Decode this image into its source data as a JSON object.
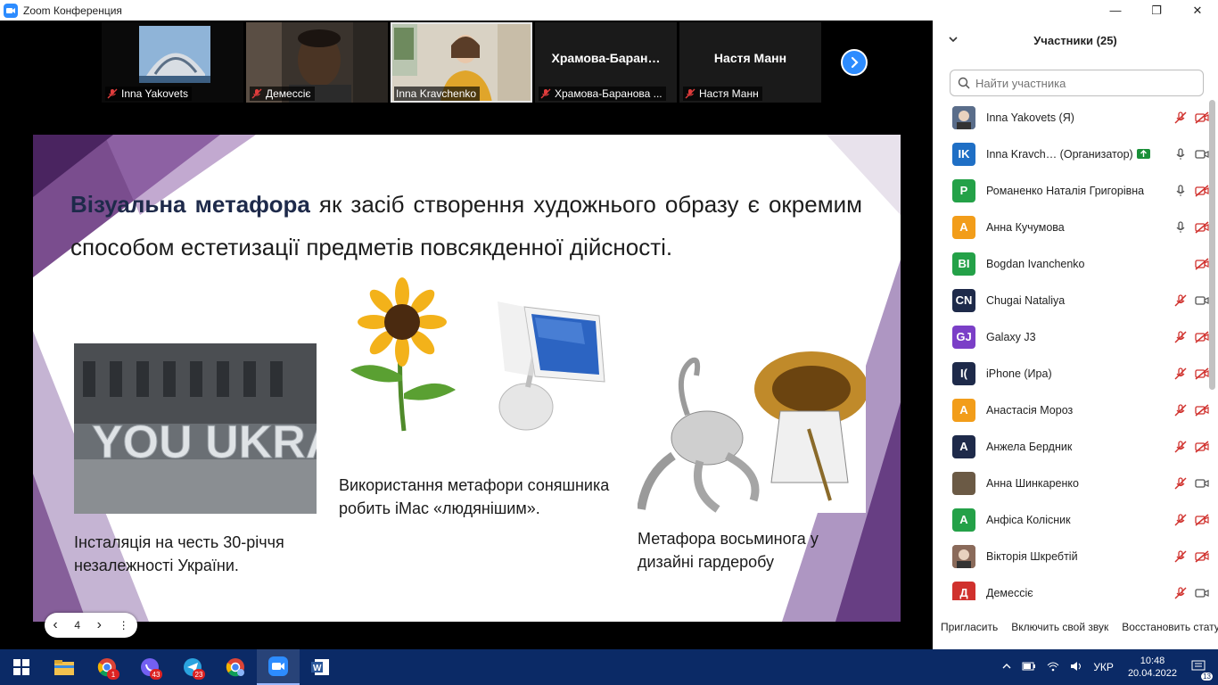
{
  "window": {
    "title": "Zoom Конференция"
  },
  "window_controls": {
    "minimize": "—",
    "restore": "❐",
    "close": "✕"
  },
  "thumbnails": [
    {
      "name": "Inna Yakovets",
      "type": "photo"
    },
    {
      "name": "Демессіє",
      "type": "video"
    },
    {
      "name": "Inna Kravchenko",
      "type": "video",
      "active": true
    },
    {
      "name": "Храмова-Баранова ...",
      "bigname": "Храмова-Баран…",
      "type": "text"
    },
    {
      "name": "Настя Манн",
      "bigname": "Настя Манн",
      "type": "text"
    }
  ],
  "slide": {
    "headline_accent_1": "Візуальна",
    "headline_accent_2": "метафора",
    "headline_rest": " як засіб створення художнього образу є окремим способом естетизації предметів повсякденної дійсності.",
    "caption_left": "Інсталяція на честь 30-річчя незалежності України.",
    "caption_middle": "Використання метафори соняшника робить iMac «людянішим».",
    "caption_right": "Метафора восьминога у дизайні гардеробу",
    "sign_text": "YOU UKRAINE"
  },
  "slide_controls": {
    "prev": "‹",
    "page": "4",
    "next": "›",
    "more": "⋮"
  },
  "panel": {
    "title": "Участники (25)",
    "search_placeholder": "Найти участника",
    "participants": [
      {
        "initials": "",
        "name": "Inna Yakovets (Я)",
        "color": "#5a6d8a",
        "photo": true,
        "mic": "muted",
        "cam": "off"
      },
      {
        "initials": "IK",
        "name": "Inna Kravch… (Организатор)",
        "color": "#1f6fc5",
        "share": true,
        "mic": "on",
        "cam": "on"
      },
      {
        "initials": "Р",
        "name": "Романенко Наталія Григорівна",
        "color": "#24a148",
        "mic": "on",
        "cam": "off"
      },
      {
        "initials": "А",
        "name": "Анна Кучумова",
        "color": "#f29d1a",
        "mic": "on",
        "cam": "off"
      },
      {
        "initials": "BI",
        "name": "Bogdan Ivanchenko",
        "color": "#24a148",
        "mic": "none",
        "cam": "off"
      },
      {
        "initials": "CN",
        "name": "Chugai Nataliya",
        "color": "#1e2a4a",
        "mic": "muted",
        "cam": "on"
      },
      {
        "initials": "GJ",
        "name": "Galaxy J3",
        "color": "#7b3fc7",
        "mic": "muted",
        "cam": "off"
      },
      {
        "initials": "I(",
        "name": "iPhone (Ира)",
        "color": "#1e2a4a",
        "mic": "muted",
        "cam": "off"
      },
      {
        "initials": "А",
        "name": "Анастасія Мороз",
        "color": "#f29d1a",
        "mic": "muted",
        "cam": "off"
      },
      {
        "initials": "А",
        "name": "Анжела Бердник",
        "color": "#1e2a4a",
        "mic": "muted",
        "cam": "off"
      },
      {
        "initials": "",
        "name": "Анна Шинкаренко",
        "color": "#6b5a45",
        "mic": "muted",
        "cam": "on"
      },
      {
        "initials": "А",
        "name": "Анфіса Колісник",
        "color": "#24a148",
        "mic": "muted",
        "cam": "off"
      },
      {
        "initials": "",
        "name": "Вікторія Шкребтій",
        "color": "#8a6a5a",
        "photo": true,
        "mic": "muted",
        "cam": "off"
      },
      {
        "initials": "Д",
        "name": "Демессіє",
        "color": "#d0312d",
        "mic": "muted",
        "cam": "on"
      }
    ],
    "footer": {
      "invite": "Пригласить",
      "unmute_self": "Включить свой звук",
      "restore": "Восстановить стату"
    }
  },
  "taskbar": {
    "apps": [
      {
        "icon": "windows-start-icon"
      },
      {
        "icon": "file-explorer-icon"
      },
      {
        "icon": "chrome-icon",
        "badge": "1"
      },
      {
        "icon": "viber-icon",
        "badge": "43"
      },
      {
        "icon": "telegram-icon",
        "badge": "23"
      },
      {
        "icon": "chrome-profile-icon"
      },
      {
        "icon": "zoom-icon",
        "active": true
      },
      {
        "icon": "word-icon"
      }
    ],
    "tray": {
      "lang": "УКР",
      "time": "10:48",
      "date": "20.04.2022",
      "notifications": "13"
    }
  },
  "colors": {
    "zoom_blue": "#2d8cff",
    "taskbar": "#0b2a66",
    "muted_red": "#d0312d"
  }
}
